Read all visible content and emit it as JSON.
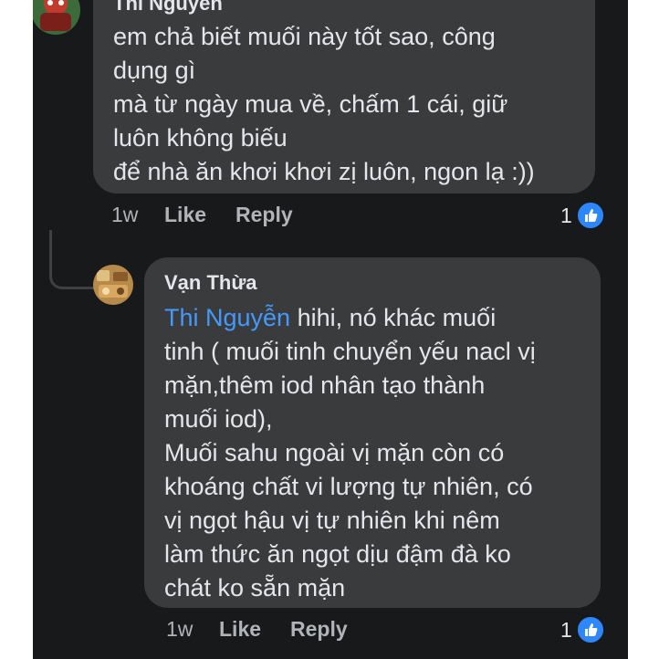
{
  "comment1": {
    "author": "Thi Nguyễn",
    "lines": [
      "em chả biết muối này tốt sao, công",
      "dụng gì",
      "mà từ ngày mua về, chấm 1 cái, giữ",
      "luôn không biếu",
      "để nhà ăn khơi khơi zị luôn, ngon lạ :))"
    ],
    "time": "1w",
    "like_label": "Like",
    "reply_label": "Reply",
    "reaction_count": "1"
  },
  "reply1": {
    "author": "Vạn Thừa",
    "mention": "Thi Nguyễn",
    "first_line_rest": " hihi, nó khác muối",
    "lines": [
      "tinh ( muối tinh chuyển yếu nacl vị",
      "mặn,thêm iod nhân tạo thành",
      "muối iod),",
      "Muối sahu ngoài vị mặn còn có",
      "khoáng chất vi lượng tự nhiên, có",
      "vị ngọt hậu vị tự nhiên khi nêm",
      "làm thức ăn ngọt dịu đậm đà ko",
      "chát ko sẵn mặn"
    ],
    "time": "1w",
    "like_label": "Like",
    "reply_label": "Reply",
    "reaction_count": "1"
  },
  "colors": {
    "background": "#18191a",
    "bubble": "#3a3b3c",
    "text": "#e4e6eb",
    "meta": "#b0b3b8",
    "mention": "#4599ff",
    "like_badge": "#2d88ff"
  }
}
